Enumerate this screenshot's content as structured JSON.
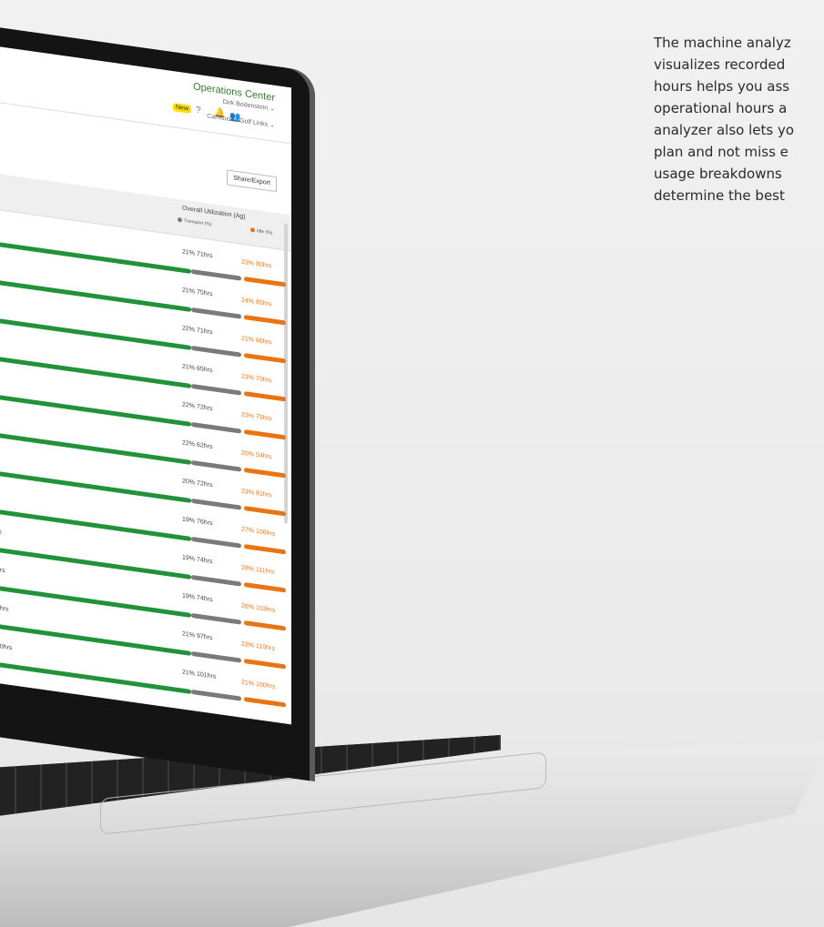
{
  "copy_lines": [
    "The machine analyz",
    "visualizes recorded",
    "hours helps you ass",
    "operational hours a",
    "analyzer also lets yo",
    "plan and not miss e",
    "usage breakdowns",
    "determine the best"
  ],
  "app": {
    "title": "Operations Center",
    "user": "Dirk Bodenstein ⌄",
    "organization": "Carnoustie Golf Links ⌄",
    "new_badge": "New",
    "share_label": "Share/Export"
  },
  "table": {
    "header": "Overall Utilization (Ag)",
    "legend_transport": "Transport (%)",
    "legend_idle": "Idle (%)",
    "rows": [
      {
        "transport": "21% 71hrs",
        "idle": "23% 80hrs"
      },
      {
        "transport": "21% 75hrs",
        "idle": "24% 85hrs"
      },
      {
        "transport": "22% 71hrs",
        "idle": "21% 66hrs"
      },
      {
        "transport": "21% 65hrs",
        "idle": "23% 70hrs"
      },
      {
        "transport": "22% 72hrs",
        "idle": "23% 75hrs"
      },
      {
        "transport": "22% 62hrs",
        "idle": "20% 54hrs"
      },
      {
        "transport": "20% 72hrs",
        "idle": "23% 81hrs"
      },
      {
        "transport": "19% 76hrs",
        "idle": "27% 106hrs"
      },
      {
        "transport": "19% 74hrs",
        "idle": "28% 111hrs"
      },
      {
        "transport": "19% 74hrs",
        "idle": "26% 103hrs"
      },
      {
        "transport": "21% 97hrs",
        "idle": "23% 110hrs"
      },
      {
        "transport": "21% 101hrs",
        "idle": "21% 100hrs"
      }
    ],
    "row_left_labels": [
      "",
      "",
      "",
      "",
      "",
      "",
      "s",
      "rs",
      "hrs",
      "9hrs",
      "62hrs",
      "270hrs"
    ]
  },
  "colors": {
    "green": "#22923a",
    "gray": "#7a7a7a",
    "orange": "#e87511",
    "brand": "#367c2b"
  }
}
